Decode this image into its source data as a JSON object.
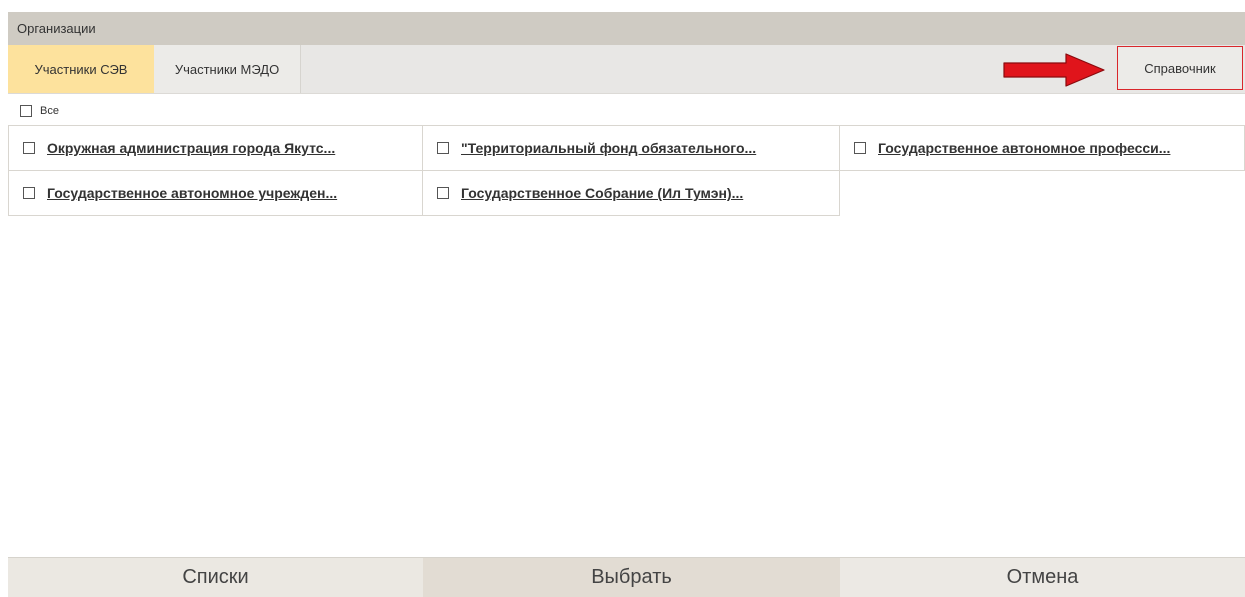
{
  "window": {
    "title": "Организации"
  },
  "tabs": [
    {
      "label": "Участники СЭВ",
      "active": true
    },
    {
      "label": "Участники МЭДО",
      "active": false
    }
  ],
  "reference_button": {
    "label": "Справочник"
  },
  "select_all": {
    "label": "Все",
    "checked": false
  },
  "organizations": [
    {
      "label": "Окружная администрация города Якутс...",
      "checked": false
    },
    {
      "label": "\"Территориальный фонд обязательного...",
      "checked": false
    },
    {
      "label": "Государственное автономное професси...",
      "checked": false
    },
    {
      "label": "Государственное автономное учрежден...",
      "checked": false
    },
    {
      "label": "Государственное Собрание (Ил Тумэн)...",
      "checked": false
    }
  ],
  "footer": {
    "lists_label": "Списки",
    "select_label": "Выбрать",
    "cancel_label": "Отмена"
  },
  "colors": {
    "title_bar": "#cfcbc3",
    "active_tab": "#fde29d",
    "highlight_border": "#d9262b",
    "arrow": "#e0141b",
    "footer_lists": "#ebe8e2",
    "footer_select": "#e2dcd3",
    "footer_cancel": "#ece9e4"
  }
}
